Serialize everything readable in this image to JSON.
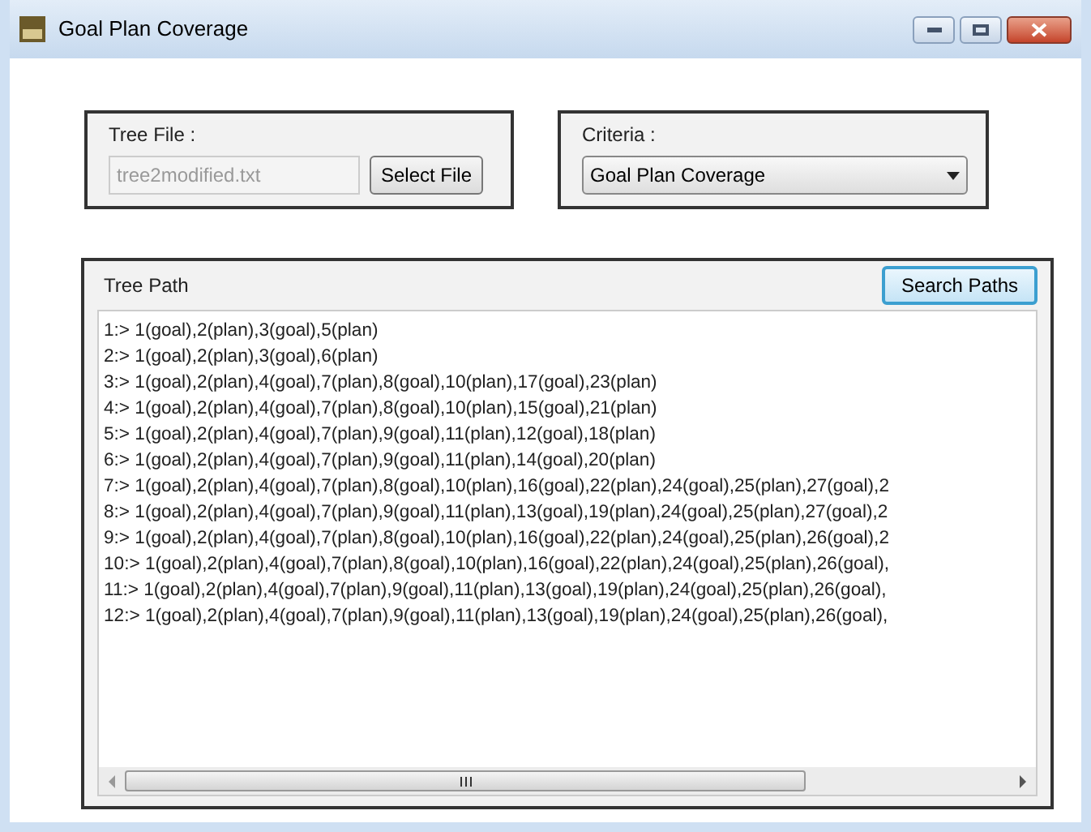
{
  "window": {
    "title": "Goal Plan Coverage"
  },
  "tree_file": {
    "label": "Tree File :",
    "value": "tree2modified.txt",
    "button": "Select File"
  },
  "criteria": {
    "label": "Criteria :",
    "value": "Goal Plan Coverage"
  },
  "tree_path": {
    "label": "Tree Path",
    "button": "Search Paths",
    "lines": [
      "1:> 1(goal),2(plan),3(goal),5(plan)",
      "2:> 1(goal),2(plan),3(goal),6(plan)",
      "3:> 1(goal),2(plan),4(goal),7(plan),8(goal),10(plan),17(goal),23(plan)",
      "4:> 1(goal),2(plan),4(goal),7(plan),8(goal),10(plan),15(goal),21(plan)",
      "5:> 1(goal),2(plan),4(goal),7(plan),9(goal),11(plan),12(goal),18(plan)",
      "6:> 1(goal),2(plan),4(goal),7(plan),9(goal),11(plan),14(goal),20(plan)",
      "7:> 1(goal),2(plan),4(goal),7(plan),8(goal),10(plan),16(goal),22(plan),24(goal),25(plan),27(goal),2",
      "8:> 1(goal),2(plan),4(goal),7(plan),9(goal),11(plan),13(goal),19(plan),24(goal),25(plan),27(goal),2",
      "9:> 1(goal),2(plan),4(goal),7(plan),8(goal),10(plan),16(goal),22(plan),24(goal),25(plan),26(goal),2",
      "10:> 1(goal),2(plan),4(goal),7(plan),8(goal),10(plan),16(goal),22(plan),24(goal),25(plan),26(goal),",
      "11:> 1(goal),2(plan),4(goal),7(plan),9(goal),11(plan),13(goal),19(plan),24(goal),25(plan),26(goal),",
      "12:> 1(goal),2(plan),4(goal),7(plan),9(goal),11(plan),13(goal),19(plan),24(goal),25(plan),26(goal),"
    ]
  }
}
